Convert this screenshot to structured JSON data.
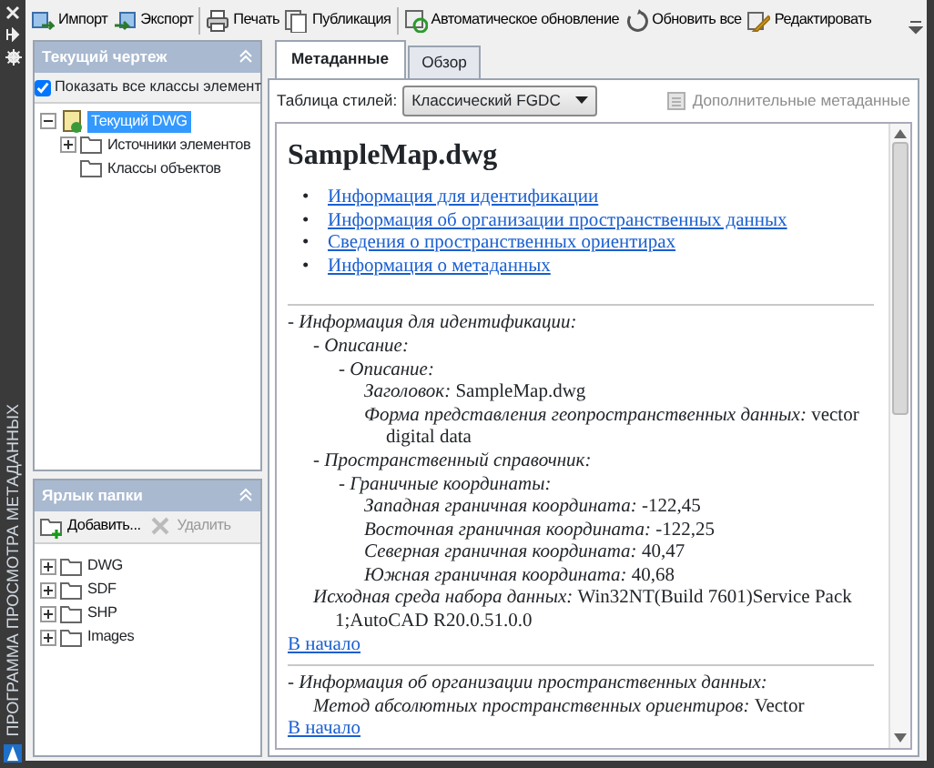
{
  "side_strip": {
    "title": "ПРОГРАММА ПРОСМОТРА МЕТАДАННЫХ"
  },
  "toolbar": {
    "groups": [
      [
        {
          "label": "Импорт",
          "kind": "import"
        },
        {
          "label": "Экспорт",
          "kind": "export"
        }
      ],
      [
        {
          "label": "Печать",
          "kind": "print"
        },
        {
          "label": "Публикация",
          "kind": "publish"
        }
      ],
      [
        {
          "label": "Автоматическое обновление",
          "kind": "auto"
        },
        {
          "label": "Обновить все",
          "kind": "refresh"
        },
        {
          "label": "Редактировать",
          "kind": "edit"
        }
      ]
    ]
  },
  "drawing_panel": {
    "title": "Текущий чертеж",
    "show_all": {
      "label": "Показать все классы элемент",
      "checked": true
    },
    "tree": [
      {
        "label": "Текущий DWG",
        "selected": true,
        "expanded": true,
        "kind": "dwg",
        "children": [
          {
            "label": "Источники элементов",
            "selected": false,
            "expanded": false,
            "kind": "folder"
          },
          {
            "label": "Классы объектов",
            "selected": false,
            "kind": "folder"
          }
        ]
      }
    ]
  },
  "folder_panel": {
    "title": "Ярлык папки",
    "buttons": [
      {
        "label": "Добавить...",
        "kind": "add",
        "disabled": false
      },
      {
        "label": "Удалить",
        "kind": "delete",
        "disabled": true
      }
    ],
    "tree": [
      {
        "label": "DWG",
        "selected": false,
        "expanded": false,
        "kind": "folder"
      },
      {
        "label": "SDF",
        "selected": false,
        "expanded": false,
        "kind": "folder"
      },
      {
        "label": "SHP",
        "selected": false,
        "expanded": false,
        "kind": "folder"
      },
      {
        "label": "Images",
        "selected": false,
        "expanded": false,
        "kind": "folder"
      }
    ]
  },
  "tabs": [
    {
      "label": "Метаданные",
      "selected": true
    },
    {
      "label": "Обзор",
      "selected": false
    }
  ],
  "style_sheet": {
    "label": "Таблица стилей:",
    "value": "Классический FGDC"
  },
  "extra_metadata_button": {
    "label": "Дополнительные метаданные",
    "disabled": true
  },
  "document": {
    "title": "SampleMap.dwg",
    "links": [
      {
        "marker": "•",
        "label": "Информация для идентификации"
      },
      {
        "marker": "•",
        "label": "Информация об организации пространственных данных"
      },
      {
        "marker": "•",
        "label": "Сведения о пространственных ориентирах"
      },
      {
        "marker": "•",
        "label": "Информация о метаданных"
      }
    ],
    "sections": [
      {
        "entries": [
          {
            "label": "- Информация для идентификации:",
            "children": [
              {
                "label": "- Описание:",
                "children": [
                  {
                    "label": "- Описание:",
                    "children": [
                      {
                        "label": "Заголовок:",
                        "value": "SampleMap.dwg"
                      },
                      {
                        "label": "Форма представления геопространственных данных:",
                        "value": "vector digital data"
                      }
                    ]
                  }
                ]
              },
              {
                "label": "- Пространственный справочник:",
                "children": [
                  {
                    "label": "- Граничные координаты:",
                    "children": [
                      {
                        "label": "Западная граничная координата:",
                        "value": "-122,45"
                      },
                      {
                        "label": "Восточная граничная координата:",
                        "value": "-122,25"
                      },
                      {
                        "label": "Северная граничная координата:",
                        "value": "40,47"
                      },
                      {
                        "label": "Южная граничная координата:",
                        "value": "40,68"
                      }
                    ]
                  }
                ]
              },
              {
                "label": "Исходная среда набора данных:",
                "value": "Win32NT(Build 7601)Service Pack 1;AutoCAD R20.0.51.0.0"
              }
            ]
          }
        ],
        "back_link": "В начало"
      },
      {
        "entries": [
          {
            "label": "- Информация об организации пространственных данных:",
            "children": [
              {
                "label": "Метод абсолютных пространственных ориентиров:",
                "value": "Vector"
              }
            ]
          }
        ],
        "back_link": "В начало"
      }
    ]
  }
}
